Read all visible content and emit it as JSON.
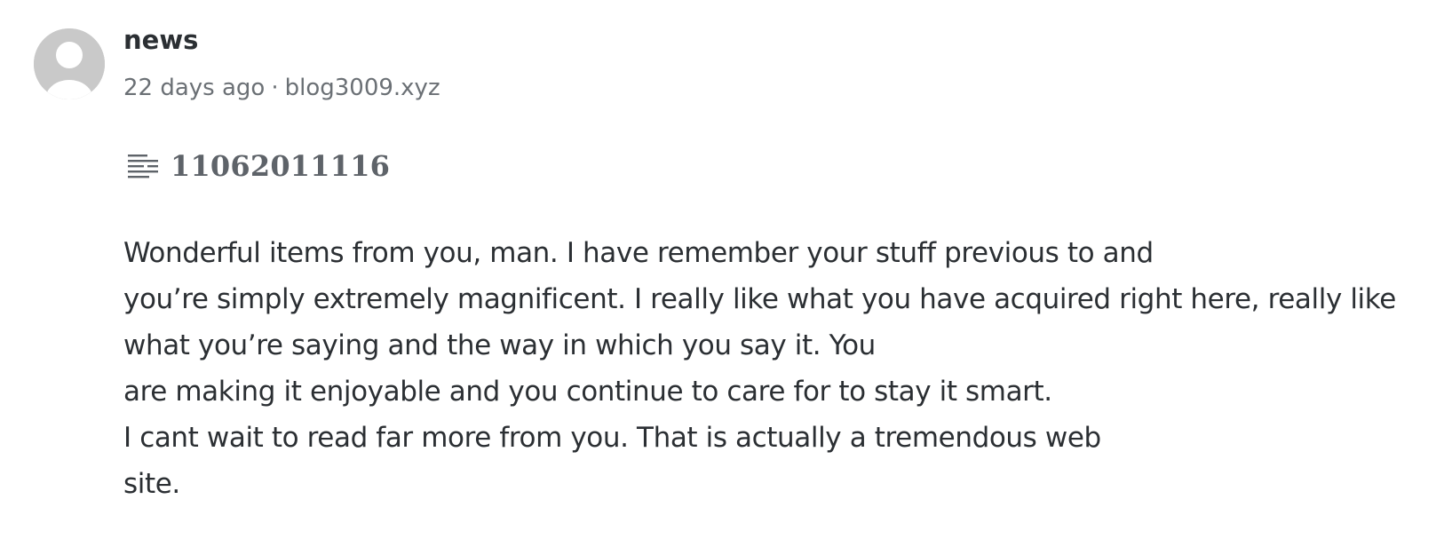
{
  "comment": {
    "author": "news",
    "time_ago": "22 days ago",
    "separator": "·",
    "site": "blog3009.xyz",
    "post_icon": "list-lines-icon",
    "post_title": "11062011116",
    "body_lines": [
      "Wonderful items from you, man. I have remember your stuff previous to and",
      "you’re simply extremely magnificent. I really like what you have acquired right here, really like",
      "what you’re saying and the way in which you say it. You",
      "are making it enjoyable and you continue to care for to stay it smart.",
      "I cant wait to read far more from you. That is actually a tremendous web",
      "site."
    ]
  },
  "colors": {
    "avatar_bg": "#c9c9c9",
    "avatar_fg": "#ffffff",
    "text": "#2b2f33",
    "muted": "#6b7075",
    "title": "#5e6369"
  }
}
